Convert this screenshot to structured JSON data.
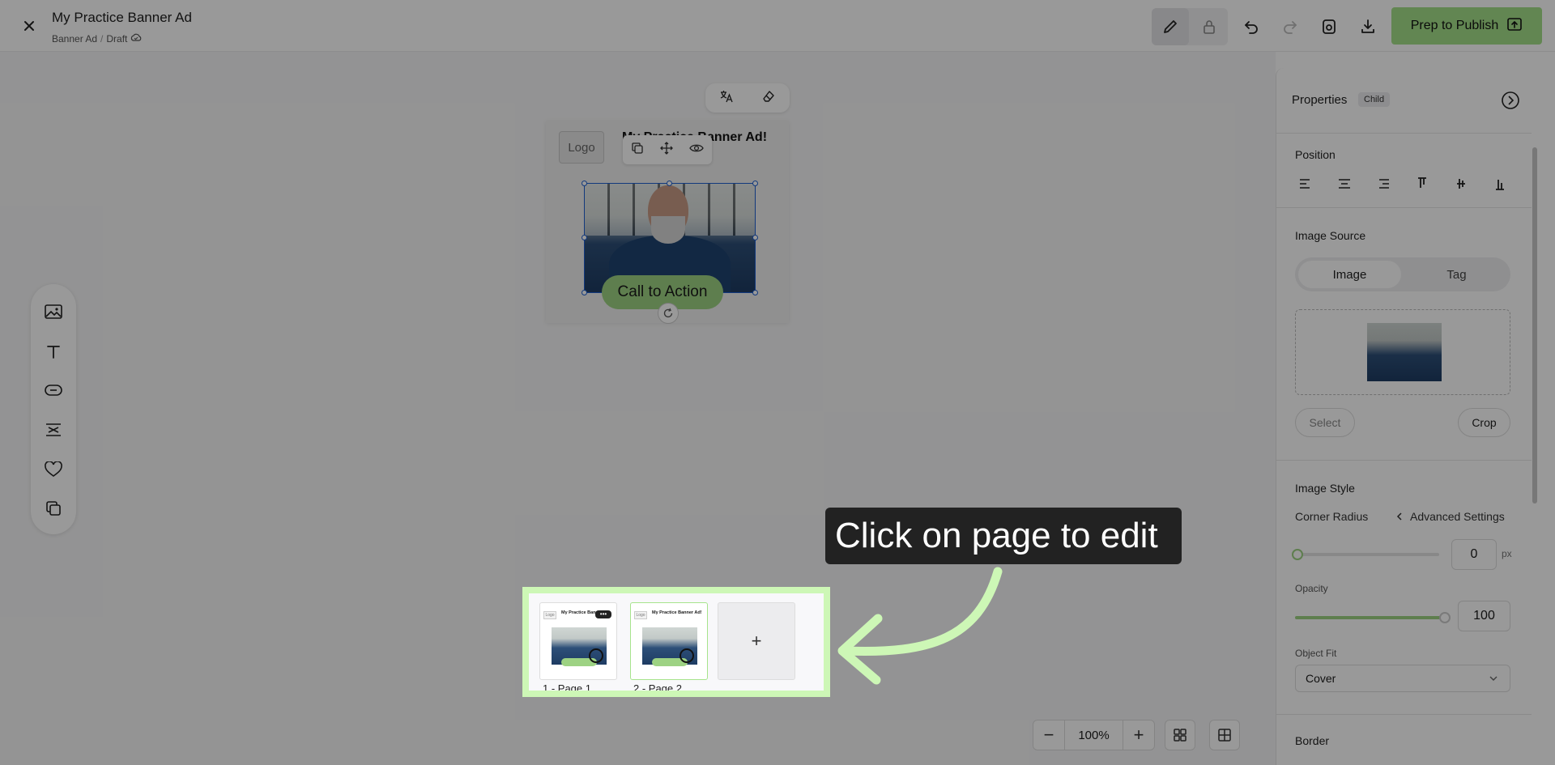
{
  "app": {
    "doc_title": "My Practice Banner Ad",
    "breadcrumb": [
      "Banner Ad",
      "Draft"
    ],
    "publish_label": "Prep to Publish"
  },
  "artboard": {
    "logo": "Logo",
    "headline": "My Practice Banner Ad!",
    "cta": "Call to Action"
  },
  "pages": {
    "items": [
      {
        "label": "1 - Page 1",
        "thumb_title": "My Practice Banner",
        "logo": "Logo",
        "more": "•••"
      },
      {
        "label": "2 - Page 2",
        "thumb_title": "My Practice Banner Ad!",
        "logo": "Logo"
      }
    ],
    "add": "+"
  },
  "tooltip": {
    "text": "Click on page to edit"
  },
  "zoom": {
    "value": "100%",
    "minus": "−",
    "plus": "+"
  },
  "properties": {
    "title": "Properties",
    "badge": "Child",
    "position_label": "Position",
    "image_source_label": "Image Source",
    "tabs": [
      "Image",
      "Tag"
    ],
    "select_label": "Select",
    "crop_label": "Crop",
    "image_style_label": "Image Style",
    "corner_radius_label": "Corner Radius",
    "advanced_label": "Advanced Settings",
    "corner_radius_value": "0",
    "corner_radius_unit": "px",
    "opacity_label": "Opacity",
    "opacity_value": "100",
    "object_fit_label": "Object Fit",
    "object_fit_value": "Cover",
    "border_label": "Border"
  },
  "colors": {
    "accent_green": "#a4e089",
    "highlight_green": "#cdf7b6",
    "selection_blue": "#1f5fd1"
  }
}
